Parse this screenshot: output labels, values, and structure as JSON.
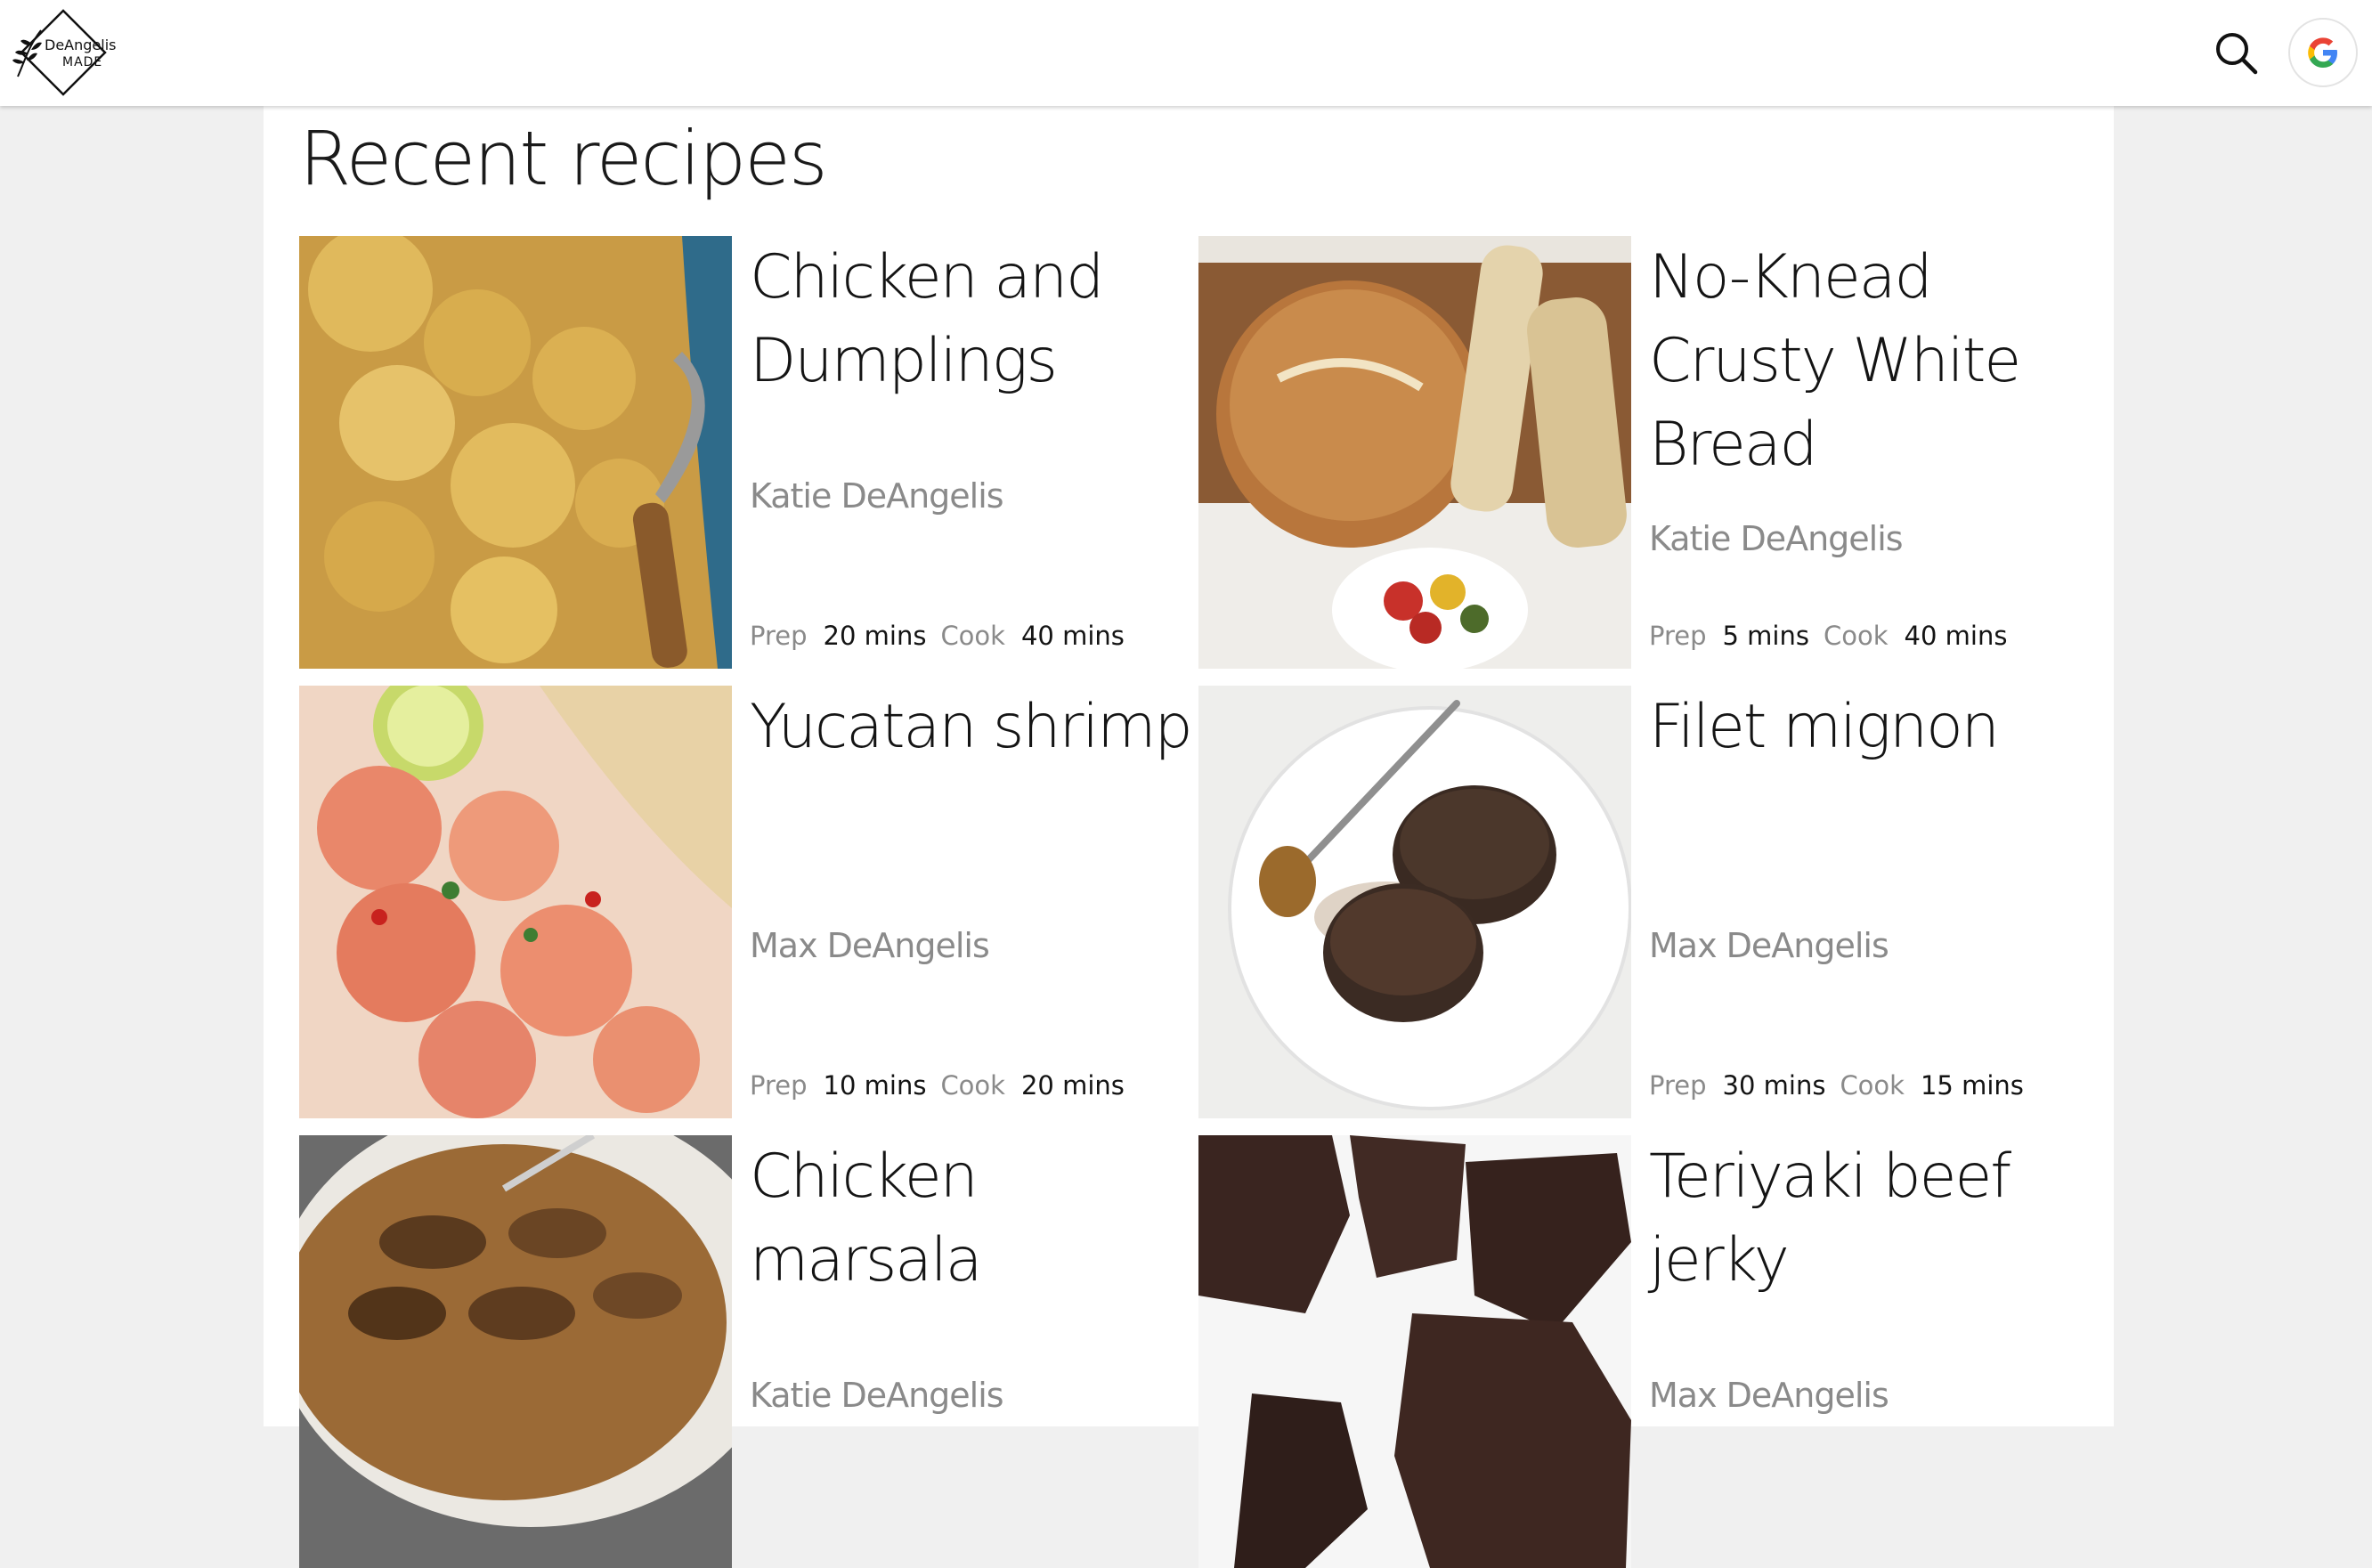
{
  "header": {
    "logo_line1": "DeAngelis",
    "logo_line2": "MADE",
    "search_icon": "search-icon",
    "account_icon": "google-icon"
  },
  "main": {
    "title": "Recent recipes",
    "prep_label": "Prep",
    "cook_label": "Cook",
    "recipes": [
      {
        "title": "Chicken and Dumplings",
        "author": "Katie DeAngelis",
        "prep": "20 mins",
        "cook": "40 mins"
      },
      {
        "title": "No-Knead Crusty White Bread",
        "author": "Katie DeAngelis",
        "prep": "5 mins",
        "cook": "40 mins"
      },
      {
        "title": "Yucatan shrimp",
        "author": "Max DeAngelis",
        "prep": "10 mins",
        "cook": "20 mins"
      },
      {
        "title": "Filet mignon",
        "author": "Max DeAngelis",
        "prep": "30 mins",
        "cook": "15 mins"
      },
      {
        "title": "Chicken marsala",
        "author": "Katie DeAngelis"
      },
      {
        "title": "Teriyaki beef jerky",
        "author": "Max DeAngelis"
      }
    ]
  }
}
